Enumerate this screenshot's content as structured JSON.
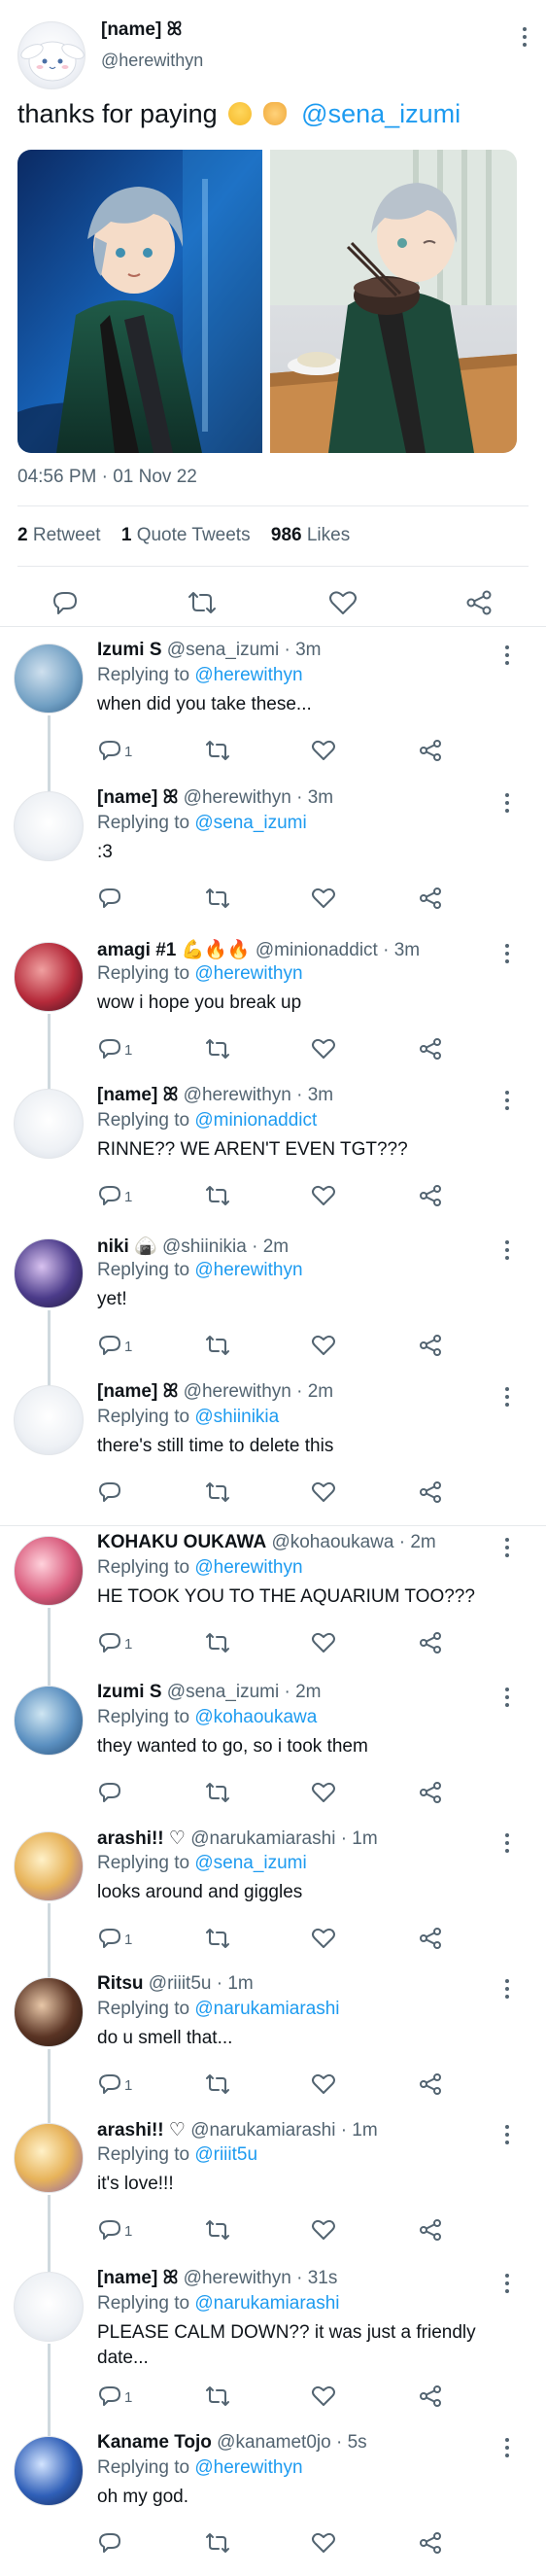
{
  "main_tweet": {
    "name": "[name] ꕤ",
    "handle": "@herewithyn",
    "text": "thanks for paying",
    "mention": "@sena_izumi",
    "timestamp": "04:56 PM · 01 Nov 22",
    "retweets": "2",
    "retweets_label": "Retweet",
    "quotes": "1",
    "quotes_label": "Quote Tweets",
    "likes": "986",
    "likes_label": "Likes"
  },
  "replies": [
    {
      "name": "Izumi S",
      "handle": "@sena_izumi · 3m",
      "replying_label": "Replying to",
      "replying_to": "@herewithyn",
      "text": "when did you take these...",
      "reply_count": "1"
    },
    {
      "name": "[name] ꕤ",
      "handle": "@herewithyn · 3m",
      "replying_label": "Replying to",
      "replying_to": "@sena_izumi",
      "text": ":3",
      "reply_count": ""
    },
    {
      "name": "amagi #1 💪🔥🔥",
      "handle": "@minionaddict · 3m",
      "replying_label": "Replying to",
      "replying_to": "@herewithyn",
      "text": "wow i hope you break up",
      "reply_count": "1"
    },
    {
      "name": "[name] ꕤ",
      "handle": "@herewithyn · 3m",
      "replying_label": "Replying to",
      "replying_to": "@minionaddict",
      "text": "RINNE?? WE AREN'T EVEN TGT???",
      "reply_count": "1"
    },
    {
      "name": "niki 🍙",
      "handle": "@shiinikia · 2m",
      "replying_label": "Replying to",
      "replying_to": "@herewithyn",
      "text": "yet!",
      "reply_count": "1"
    },
    {
      "name": "[name] ꕤ",
      "handle": "@herewithyn · 2m",
      "replying_label": "Replying to",
      "replying_to": "@shiinikia",
      "text": "there's still time to delete this",
      "reply_count": ""
    },
    {
      "name": "KOHAKU OUKAWA",
      "handle": "@kohaoukawa · 2m",
      "replying_label": "Replying to",
      "replying_to": "@herewithyn",
      "text": "HE TOOK YOU TO THE AQUARIUM TOO???",
      "reply_count": "1"
    },
    {
      "name": "Izumi S",
      "handle": "@sena_izumi · 2m",
      "replying_label": "Replying to",
      "replying_to": "@kohaoukawa",
      "text": "they wanted to go, so i took them",
      "reply_count": ""
    },
    {
      "name": "arashi!! ♡",
      "handle": "@narukamiarashi · 1m",
      "replying_label": "Replying to",
      "replying_to": "@sena_izumi",
      "text": "looks around and giggles",
      "reply_count": "1"
    },
    {
      "name": "Ritsu",
      "handle": "@riiit5u · 1m",
      "replying_label": "Replying to",
      "replying_to": "@narukamiarashi",
      "text": "do u smell that...",
      "reply_count": "1"
    },
    {
      "name": "arashi!! ♡",
      "handle": "@narukamiarashi · 1m",
      "replying_label": "Replying to",
      "replying_to": "@riiit5u",
      "text": "it's love!!!",
      "reply_count": "1"
    },
    {
      "name": "[name] ꕤ",
      "handle": "@herewithyn · 31s",
      "replying_label": "Replying to",
      "replying_to": "@narukamiarashi",
      "text": "PLEASE CALM DOWN?? it was just a friendly",
      "text2": "date...",
      "reply_count": "1"
    },
    {
      "name": "Kaname Tojo",
      "handle": "@kanamet0jo · 5s",
      "replying_label": "Replying to",
      "replying_to": "@herewithyn",
      "text": "oh my god.",
      "reply_count": ""
    }
  ],
  "colors": {
    "link": "#1d9bf0",
    "muted": "#536471",
    "text": "#0f1419",
    "thread_line": "#cfd9de"
  }
}
